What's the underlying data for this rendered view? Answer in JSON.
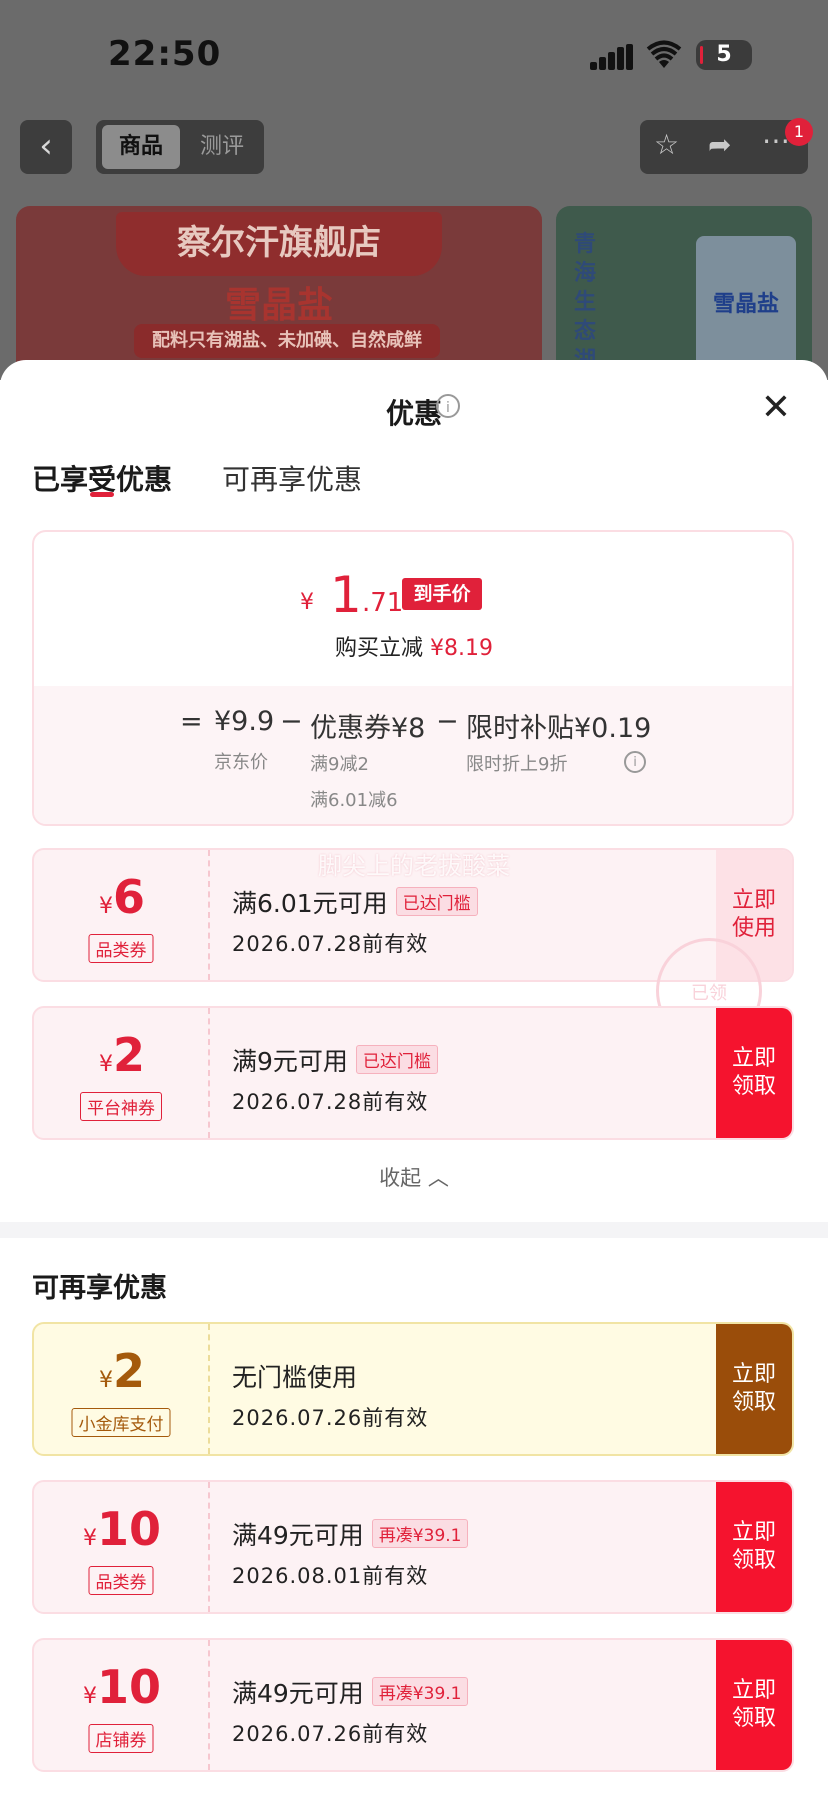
{
  "status": {
    "time": "22:50",
    "battery": "5"
  },
  "nav": {
    "back": "‹",
    "tab_goods": "商品",
    "tab_review": "测评",
    "notif_count": "1",
    "icons": [
      "star-icon",
      "share-icon",
      "more-icon"
    ]
  },
  "banner": {
    "store": "察尔汗旗舰店",
    "product": "雪晶盐",
    "sub": "配料只有湖盐、未加碘、自然咸鲜",
    "side_text": "青海生态湖",
    "bag_label": "雪晶盐"
  },
  "sheet": {
    "title": "优惠",
    "close": "✕",
    "tab_enjoyed": "已享受优惠",
    "tab_more": "可再享优惠"
  },
  "summary": {
    "currency": "¥",
    "price_int": "1",
    "price_dec": ".71",
    "price_tag": "到手价",
    "save_label": "购买立减",
    "save_amount": "¥8.19",
    "eq": "=",
    "jd_price": "¥9.9",
    "jd_label": "京东价",
    "minus": "−",
    "coupon_label": "优惠券¥8",
    "coupon_sub1": "满9减2",
    "coupon_sub2": "满6.01减6",
    "subsidy_label": "限时补贴¥0.19",
    "subsidy_sub": "限时折上9折"
  },
  "watermark": "脚尖上的老拔酸菜",
  "stamp": "已领",
  "coupons_enjoyed": [
    {
      "yen": "¥",
      "amount": "6",
      "kind": "品类券",
      "cond": "满6.01元可用",
      "tag": "已达门槛",
      "date": "2026.07.28前有效",
      "action": "立即\n使用"
    },
    {
      "yen": "¥",
      "amount": "2",
      "kind": "平台神券",
      "cond": "满9元可用",
      "tag": "已达门槛",
      "date": "2026.07.28前有效",
      "action": "立即\n领取"
    }
  ],
  "collapse": "收起",
  "section_more": "可再享优惠",
  "coupons_more": [
    {
      "yen": "¥",
      "amount": "2",
      "kind": "小金库支付",
      "cond": "无门槛使用",
      "tag": "",
      "date": "2026.07.26前有效",
      "action": "立即\n领取"
    },
    {
      "yen": "¥",
      "amount": "10",
      "kind": "品类券",
      "cond": "满49元可用",
      "tag": "再凑¥39.1",
      "date": "2026.08.01前有效",
      "action": "立即\n领取"
    },
    {
      "yen": "¥",
      "amount": "10",
      "kind": "店铺券",
      "cond": "满49元可用",
      "tag": "再凑¥39.1",
      "date": "2026.07.26前有效",
      "action": "立即\n领取"
    }
  ],
  "colors": {
    "accent": "#e0213a",
    "gold": "#a45a0c",
    "brown_btn": "#9a4d0a"
  }
}
